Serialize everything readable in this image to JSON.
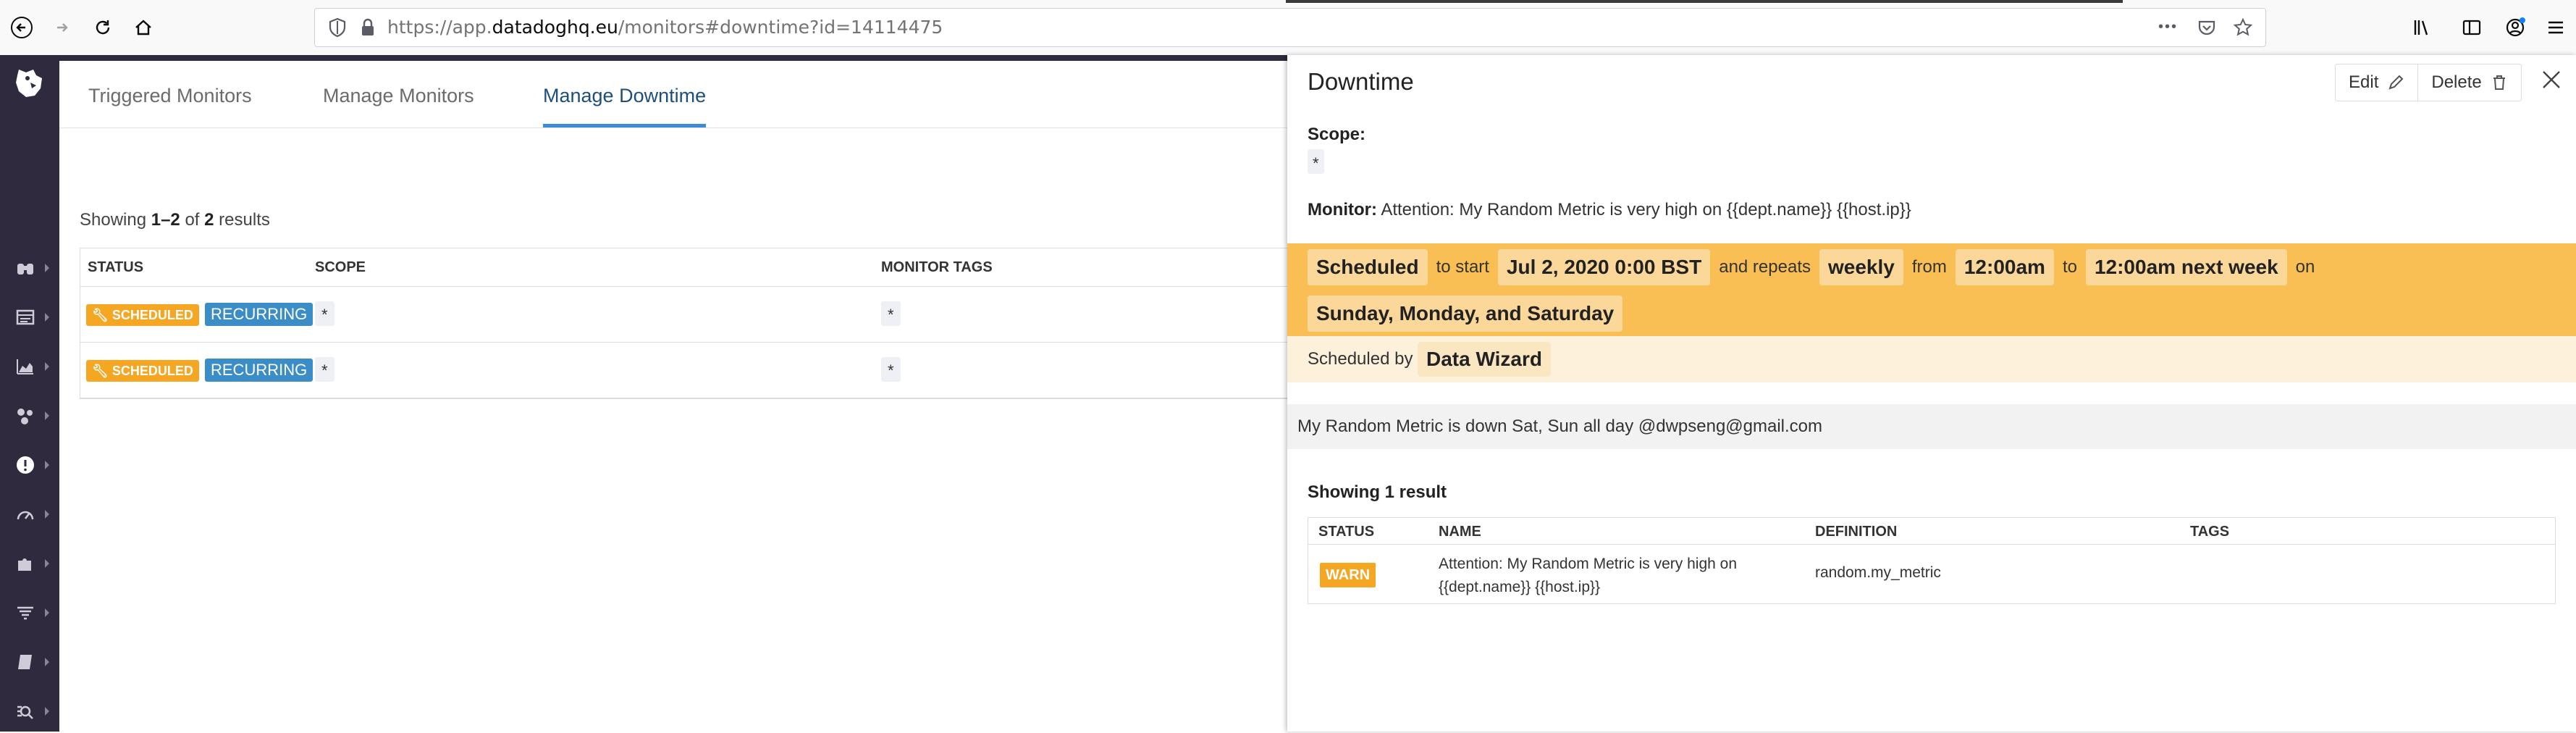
{
  "browser": {
    "url_prefix": "https://app.",
    "url_host": "datadoghq.eu",
    "url_path": "/monitors#downtime?id=14114475",
    "page_actions_glyph": "•••"
  },
  "tabs": [
    {
      "label": "Triggered Monitors"
    },
    {
      "label": "Manage Monitors"
    },
    {
      "label": "Manage Downtime"
    }
  ],
  "downtime_list": {
    "showing_prefix": "Showing ",
    "showing_range": "1–2",
    "showing_of": " of ",
    "showing_total": "2",
    "showing_suffix": " results",
    "columns": {
      "status": "STATUS",
      "scope": "SCOPE",
      "monitor_tags": "MONITOR TAGS"
    },
    "rows": [
      {
        "status": "SCHEDULED",
        "type": "RECURRING",
        "scope": "*",
        "tags": "*"
      },
      {
        "status": "SCHEDULED",
        "type": "RECURRING",
        "scope": "*",
        "tags": "*"
      }
    ]
  },
  "panel": {
    "title": "Downtime",
    "edit_label": "Edit",
    "delete_label": "Delete",
    "scope_label": "Scope:",
    "scope_value": "*",
    "monitor_label": "Monitor:",
    "monitor_value": "Attention: My Random Metric is very high on {{dept.name}} {{host.ip}}",
    "schedule": {
      "status": "Scheduled",
      "to_start": "to start",
      "start": "Jul 2, 2020 0:00 BST",
      "and_repeats": "and repeats",
      "frequency": "weekly",
      "from": "from",
      "from_time": "12:00am",
      "to": "to",
      "to_time": "12:00am next week",
      "on": "on",
      "days": "Sunday, Monday, and Saturday"
    },
    "scheduled_by_label": "Scheduled by",
    "scheduled_by": "Data Wizard",
    "message": "My Random Metric is down Sat, Sun all day @dwpseng@gmail.com",
    "showing_result": "Showing 1 result",
    "columns": {
      "status": "STATUS",
      "name": "NAME",
      "definition": "DEFINITION",
      "tags": "TAGS"
    },
    "monitor_row": {
      "status": "WARN",
      "name_line1": "Attention: My Random Metric is very high on",
      "name_line2": "{{dept.name}} {{host.ip}}",
      "definition": "random.my_metric",
      "tags": ""
    }
  },
  "colors": {
    "sidebar": "#2f2a3d",
    "accent_tab": "#3b8bd6",
    "scheduled_badge": "#f5a623",
    "recurring_badge": "#3b8dc8",
    "schedule_band": "#f9bf55"
  }
}
